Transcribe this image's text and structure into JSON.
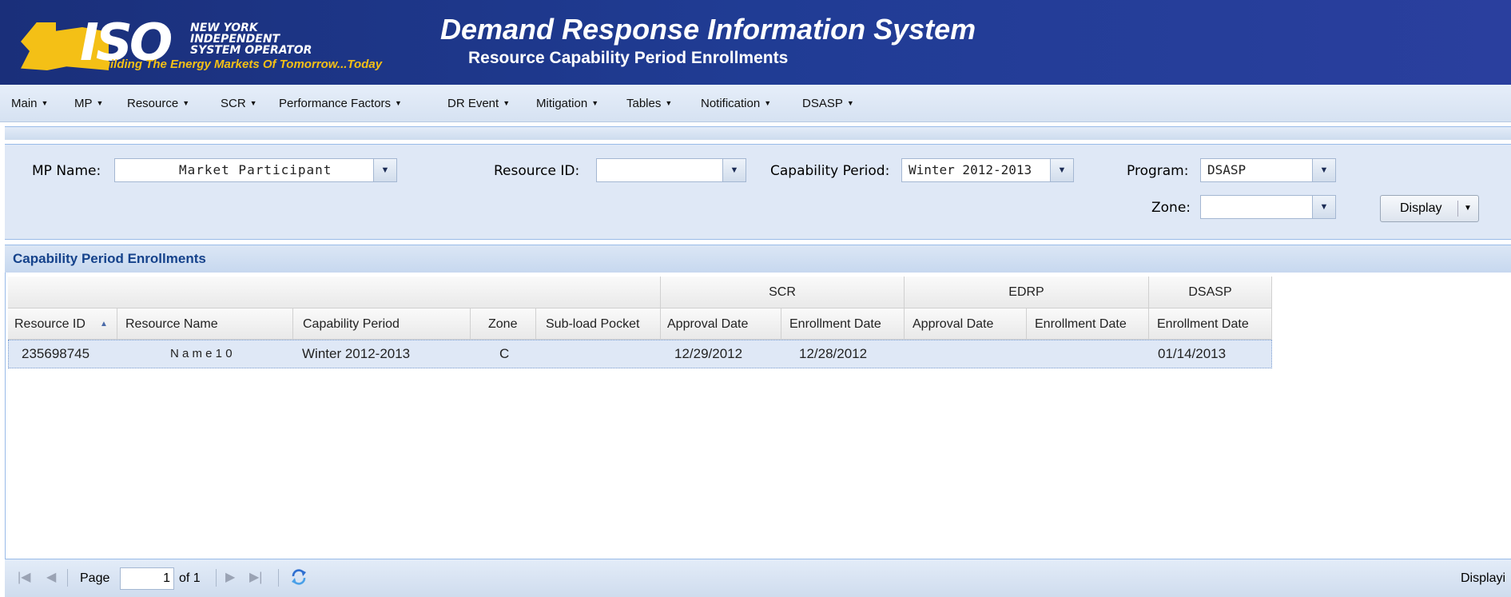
{
  "header": {
    "logo": {
      "iso": "ISO",
      "line1": "NEW YORK",
      "line2": "INDEPENDENT",
      "line3": "SYSTEM OPERATOR",
      "tagline": "Building The Energy Markets Of Tomorrow...Today"
    },
    "title": "Demand Response Information System",
    "subtitle": "Resource Capability Period Enrollments"
  },
  "menu": [
    {
      "label": "Main"
    },
    {
      "label": "MP"
    },
    {
      "label": "Resource"
    },
    {
      "label": "SCR"
    },
    {
      "label": "Performance Factors"
    },
    {
      "label": "DR Event"
    },
    {
      "label": "Mitigation"
    },
    {
      "label": "Tables"
    },
    {
      "label": "Notification"
    },
    {
      "label": "DSASP"
    }
  ],
  "filters": {
    "mp_name": {
      "label": "MP Name:",
      "value": "Market Participant"
    },
    "resource_id": {
      "label": "Resource ID:",
      "value": ""
    },
    "capability_period": {
      "label": "Capability Period:",
      "value": "Winter 2012-2013"
    },
    "program": {
      "label": "Program:",
      "value": "DSASP"
    },
    "zone": {
      "label": "Zone:",
      "value": ""
    },
    "display_button": "Display"
  },
  "grid": {
    "title": "Capability Period Enrollments",
    "groups": [
      "SCR",
      "EDRP",
      "DSASP"
    ],
    "columns": [
      "Resource ID",
      "Resource Name",
      "Capability Period",
      "Zone",
      "Sub-load Pocket",
      "Approval Date",
      "Enrollment Date",
      "Approval Date",
      "Enrollment Date",
      "Enrollment Date"
    ],
    "rows": [
      [
        "235698745",
        "N a m e 1 0",
        "Winter 2012-2013",
        "C",
        "",
        "12/29/2012",
        "12/28/2012",
        "",
        "",
        "01/14/2013"
      ]
    ]
  },
  "pager": {
    "page_label": "Page",
    "page_value": "1",
    "of_label": "of 1",
    "status": "Displayi"
  },
  "colors": {
    "header_bg": "#203c94",
    "logo_yellow": "#f4c016",
    "panel_bg": "#dfe8f6",
    "grid_title": "#15428b"
  }
}
